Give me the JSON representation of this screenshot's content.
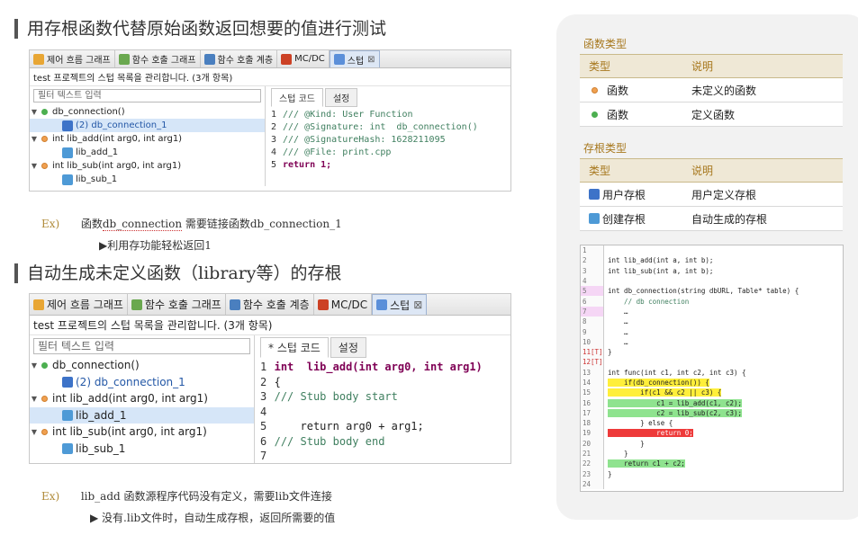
{
  "section1": {
    "title": "用存根函数代替原始函数返回想要的值进行测试",
    "tabs": [
      "제어 흐름 그래프",
      "함수 호출 그래프",
      "함수 호출 계층",
      "MC/DC",
      "스텁"
    ],
    "desc": "test 프로젝트의 스텁 목록을 관리합니다. (3개 항목)",
    "filter_placeholder": "필터 텍스트 입력",
    "tree": [
      {
        "label": "db_connection()",
        "status": "defined",
        "children": [
          {
            "label": "(2) db_connection_1",
            "kind": "user",
            "selected": true
          }
        ]
      },
      {
        "label": "int  lib_add(int arg0, int arg1)",
        "status": "undefined",
        "children": [
          {
            "label": "lib_add_1",
            "kind": "auto",
            "selected": false
          }
        ]
      },
      {
        "label": "int  lib_sub(int arg0, int arg1)",
        "status": "undefined",
        "children": [
          {
            "label": "lib_sub_1",
            "kind": "auto",
            "selected": false
          }
        ]
      }
    ],
    "right_tabs": [
      "스텁 코드",
      "설정"
    ],
    "code": [
      {
        "n": "1",
        "t": "/// @Kind: User Function"
      },
      {
        "n": "2",
        "t": "/// @Signature: int  db_connection()"
      },
      {
        "n": "3",
        "t": "/// @SignatureHash: 1628211095"
      },
      {
        "n": "4",
        "t": "/// @File: print.cpp"
      },
      {
        "n": "5",
        "t": "return 1;"
      }
    ],
    "ex_label": "Ex)",
    "ex_text_a": "函数",
    "ex_text_b": "db_connection",
    "ex_text_c": " 需要链接函数",
    "ex_text_d": "db_connection_1",
    "ex_sub": "▶利用存功能轻松返回1"
  },
  "section2": {
    "title": "自动生成未定义函数（library等）的存根",
    "tabs": [
      "제어 흐름 그래프",
      "함수 호출 그래프",
      "함수 호출 계층",
      "MC/DC",
      "스텁"
    ],
    "desc": "test 프로젝트의 스텁 목록을 관리합니다. (3개 항목)",
    "filter_placeholder": "필터 텍스트 입력",
    "tree": [
      {
        "label": "db_connection()",
        "status": "defined",
        "children": [
          {
            "label": "(2) db_connection_1",
            "kind": "user",
            "selected": false
          }
        ]
      },
      {
        "label": "int  lib_add(int arg0, int arg1)",
        "status": "undefined",
        "children": [
          {
            "label": "lib_add_1",
            "kind": "auto",
            "selected": true
          }
        ]
      },
      {
        "label": "int  lib_sub(int arg0, int arg1)",
        "status": "undefined",
        "children": [
          {
            "label": "lib_sub_1",
            "kind": "auto",
            "selected": false
          }
        ]
      }
    ],
    "right_tabs": [
      "* 스텁 코드",
      "설정"
    ],
    "code": [
      {
        "n": "1",
        "t": "int  lib_add(int arg0, int arg1)"
      },
      {
        "n": "2",
        "t": "{"
      },
      {
        "n": "3",
        "t": "/// Stub body start"
      },
      {
        "n": "4",
        "t": ""
      },
      {
        "n": "5",
        "t": "    return arg0 + arg1;"
      },
      {
        "n": "6",
        "t": "/// Stub body end"
      },
      {
        "n": "7",
        "t": ""
      }
    ],
    "ex_label": "Ex)",
    "ex_text": "lib_add 函数源程序代码没有定义，需要lib文件连接",
    "ex_sub": "▶ 没有.lib文件时，自动生成存根，返回所需要的值"
  },
  "sidebar": {
    "func_types_title": "函数类型",
    "func_header": [
      "类型",
      "说明"
    ],
    "func_rows": [
      {
        "type": "函数",
        "desc": "未定义的函数",
        "icon": "orange-dot"
      },
      {
        "type": "函数",
        "desc": "定义函数",
        "icon": "green-dot"
      }
    ],
    "stub_types_title": "存根类型",
    "stub_header": [
      "类型",
      "说明"
    ],
    "stub_rows": [
      {
        "type": "用户存根",
        "desc": "用户定义存根",
        "icon": "user-stub-icon"
      },
      {
        "type": "创建存根",
        "desc": "自动生成的存根",
        "icon": "auto-stub-icon"
      }
    ],
    "code_lines": [
      {
        "n": "1",
        "t": "",
        "hl": ""
      },
      {
        "n": "2",
        "t": "int lib_add(int a, int b);",
        "hl": ""
      },
      {
        "n": "3",
        "t": "int lib_sub(int a, int b);",
        "hl": ""
      },
      {
        "n": "4",
        "t": "",
        "hl": ""
      },
      {
        "n": "5",
        "t": "int db_connection(string dbURL, Table* table) {",
        "hl": ""
      },
      {
        "n": "6",
        "t": "    // db connection",
        "hl": ""
      },
      {
        "n": "7",
        "t": "    …",
        "hl": ""
      },
      {
        "n": "8",
        "t": "    …",
        "hl": ""
      },
      {
        "n": "9",
        "t": "    …",
        "hl": ""
      },
      {
        "n": "10",
        "t": "    …",
        "hl": ""
      },
      {
        "n": "11[T]",
        "t": "}",
        "hl": ""
      },
      {
        "n": "12[T]",
        "t": "",
        "hl": ""
      },
      {
        "n": "13",
        "t": "int func(int c1, int c2, int c3) {",
        "hl": ""
      },
      {
        "n": "14",
        "t": "    if(db_connection()) {",
        "hl": "y"
      },
      {
        "n": "15",
        "t": "        if(c1 && c2 || c3) {",
        "hl": "y"
      },
      {
        "n": "16",
        "t": "            c1 = lib_add(c1, c2);",
        "hl": "g"
      },
      {
        "n": "17",
        "t": "            c2 = lib_sub(c2, c3);",
        "hl": "g"
      },
      {
        "n": "18",
        "t": "        } else {",
        "hl": ""
      },
      {
        "n": "19",
        "t": "            return 0;",
        "hl": "r"
      },
      {
        "n": "20",
        "t": "        }",
        "hl": ""
      },
      {
        "n": "21",
        "t": "    }",
        "hl": ""
      },
      {
        "n": "22",
        "t": "    return c1 + c2;",
        "hl": "g"
      },
      {
        "n": "23",
        "t": "}",
        "hl": ""
      },
      {
        "n": "24",
        "t": "",
        "hl": ""
      }
    ]
  }
}
